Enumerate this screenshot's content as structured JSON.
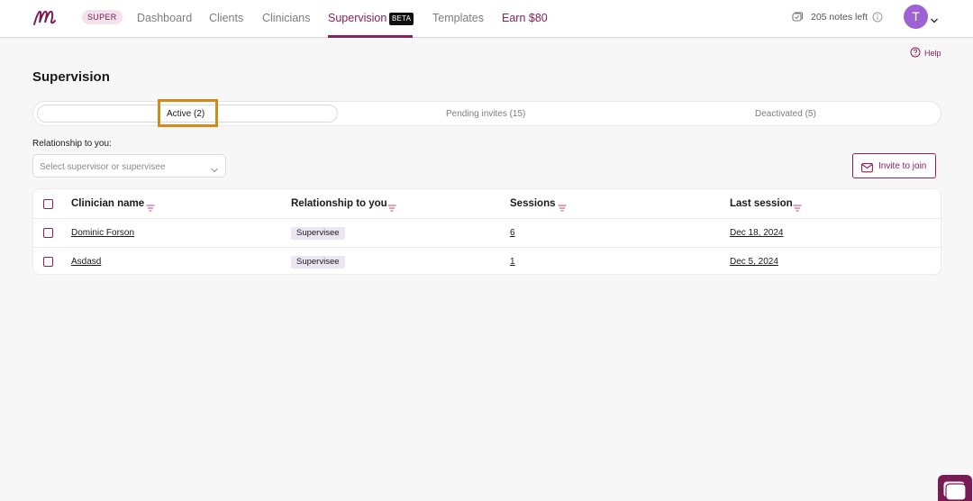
{
  "nav": {
    "logo": "m",
    "plan_badge": "SUPER",
    "items": [
      {
        "label": "Dashboard"
      },
      {
        "label": "Clients"
      },
      {
        "label": "Clinicians"
      },
      {
        "label": "Supervision"
      },
      {
        "label": "Templates"
      },
      {
        "label": "Earn $80"
      }
    ],
    "beta_badge": "BETA",
    "notes_left": "205 notes left",
    "avatar_initial": "T"
  },
  "help_label": "Help",
  "page_title": "Supervision",
  "tabs": [
    {
      "label": "Active (2)",
      "active": true
    },
    {
      "label": "Pending invites (15)",
      "active": false
    },
    {
      "label": "Deactivated (5)",
      "active": false
    }
  ],
  "filter": {
    "label": "Relationship to you:",
    "placeholder": "Select supervisor or supervisee"
  },
  "invite_button": "Invite to join",
  "table": {
    "headers": [
      "Clinician name",
      "Relationship to you",
      "Sessions",
      "Last session"
    ],
    "rows": [
      {
        "name": "Dominic Forson",
        "relationship": "Supervisee",
        "sessions": "6",
        "last_session": "Dec 18, 2024"
      },
      {
        "name": "Asdasd",
        "relationship": "Supervisee",
        "sessions": "1",
        "last_session": "Dec 5, 2024"
      }
    ]
  },
  "colors": {
    "brand": "#8a1e5e",
    "avatar": "#9e62d4",
    "focus_outline": "#d48a18",
    "page_bg": "#f7f7f8"
  },
  "icons": {
    "logo": "m-logo-icon",
    "notes": "notes-icon",
    "info": "info-icon",
    "caret": "chevron-down-icon",
    "help": "help-circle-icon",
    "mail": "mail-icon",
    "sort": "filter-sort-icon",
    "chat": "chat-icon"
  }
}
